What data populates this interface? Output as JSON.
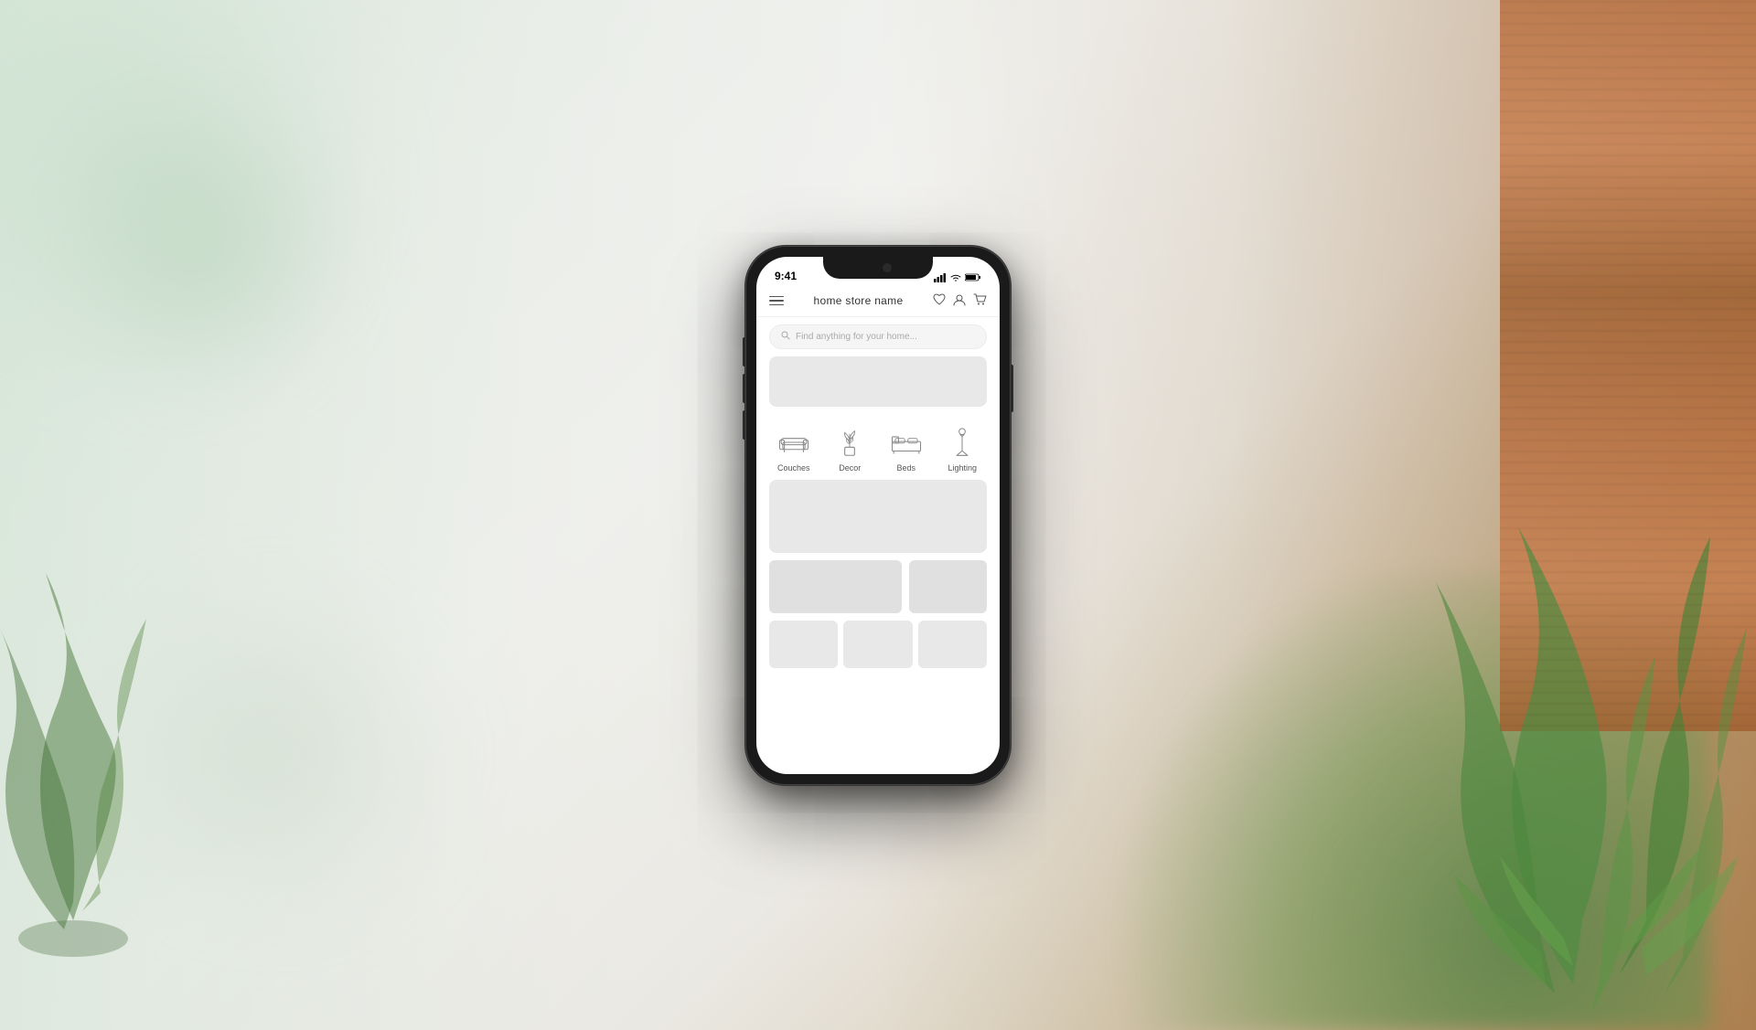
{
  "background": {
    "colors": {
      "primary": "#d6e8d8",
      "secondary": "#f0f0ee",
      "wood": "#b87040"
    }
  },
  "phone": {
    "status_bar": {
      "time": "9:41",
      "signal": "▌▌▌",
      "wifi": "WiFi",
      "battery": "Battery"
    },
    "header": {
      "menu_label": "☰",
      "title": "home store name",
      "icons": {
        "wishlist": "♡",
        "account": "👤",
        "cart": "🛒"
      }
    },
    "search": {
      "placeholder": "Find anything for your home..."
    },
    "categories": [
      {
        "id": "couches",
        "label": "Couches"
      },
      {
        "id": "decor",
        "label": "Decor"
      },
      {
        "id": "beds",
        "label": "Beds"
      },
      {
        "id": "lighting",
        "label": "Lighting"
      }
    ]
  }
}
